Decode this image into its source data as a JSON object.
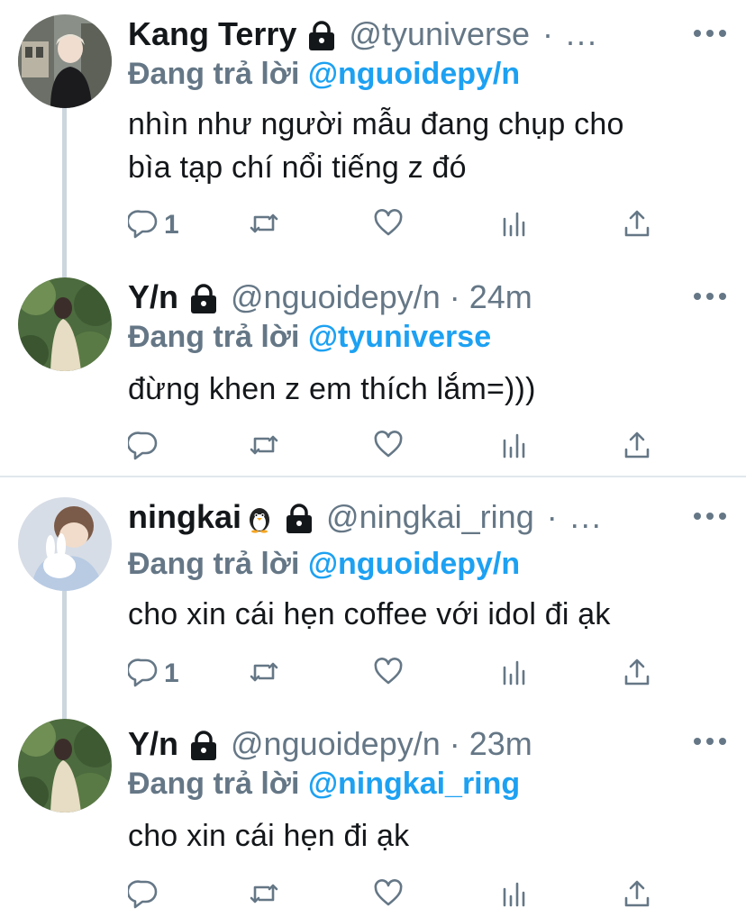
{
  "tweets": [
    {
      "name": "Kang Terry",
      "name_emoji": "",
      "handle": "@tyuniverse",
      "time": "",
      "header_ellipsis": "· ...",
      "reply_prefix": "Đang trả lời ",
      "reply_to": "@nguoidepy/n",
      "text_lines": [
        "nhìn như người mẫu đang chụp cho",
        "bìa tạp chí nổi tiếng z đó"
      ],
      "reply_count": "1",
      "avatar_icon": "boy-portrait"
    },
    {
      "name": "Y/n",
      "name_emoji": "",
      "handle": "@nguoidepy/n",
      "time": "24m",
      "header_ellipsis": "",
      "reply_prefix": "Đang trả lời ",
      "reply_to": "@tyuniverse",
      "text_lines": [
        "đừng khen z em thích lắm=)))"
      ],
      "reply_count": "",
      "avatar_icon": "girl-in-forest"
    },
    {
      "name": "ningkai",
      "name_emoji": "penguin-emoji",
      "handle": "@ningkai_ring",
      "time": "",
      "header_ellipsis": "· ...",
      "reply_prefix": "Đang trả lời ",
      "reply_to": "@nguoidepy/n",
      "text_lines": [
        "cho xin cái hẹn coffee với idol đi ạk"
      ],
      "reply_count": "1",
      "avatar_icon": "boy-with-plush"
    },
    {
      "name": "Y/n",
      "name_emoji": "",
      "handle": "@nguoidepy/n",
      "time": "23m",
      "header_ellipsis": "",
      "reply_prefix": "Đang trả lời ",
      "reply_to": "@ningkai_ring",
      "text_lines": [
        "cho xin cái hẹn đi ạk"
      ],
      "reply_count": "",
      "avatar_icon": "girl-in-forest"
    }
  ],
  "colors": {
    "text": "#14171a",
    "secondary": "#657786",
    "accent": "#1da1f2",
    "thread_line": "#ccd6dd",
    "divider": "#e1e8ed"
  },
  "icons": {
    "lock": "lock-icon",
    "more": "more-options-icon",
    "reply": "reply-icon",
    "retweet": "retweet-icon",
    "like": "heart-icon",
    "analytics": "analytics-icon",
    "share": "share-icon"
  }
}
